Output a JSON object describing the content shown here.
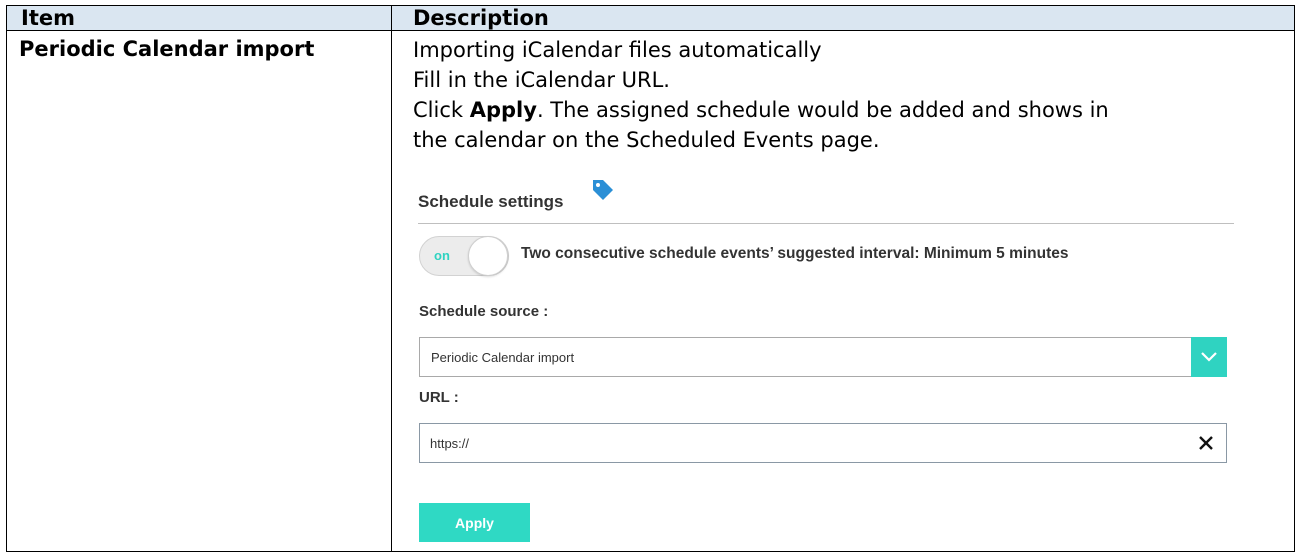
{
  "table": {
    "headers": {
      "item": "Item",
      "description": "Description"
    },
    "row": {
      "item": "Periodic Calendar import",
      "lines": [
        {
          "text": "Importing iCalendar files automatically"
        },
        {
          "text": "Fill in the iCalendar URL."
        },
        {
          "pre": "Click ",
          "bold": "Apply",
          "post": ". The assigned schedule would be added and shows in"
        },
        {
          "text": "the calendar on the Scheduled Events page."
        }
      ]
    }
  },
  "panel": {
    "section_title": "Schedule settings",
    "tag_icon": "tag-icon",
    "toggle": {
      "label": "on",
      "state": true
    },
    "toggle_text": "Two consecutive schedule events’ suggested interval: Minimum 5 minutes",
    "source_label": "Schedule source :",
    "source_value": "Periodic Calendar import",
    "url_label": "URL :",
    "url_value": "https://",
    "apply_label": "Apply",
    "colors": {
      "accent": "#2fd3c1",
      "header_bg": "#dae6f1"
    }
  }
}
